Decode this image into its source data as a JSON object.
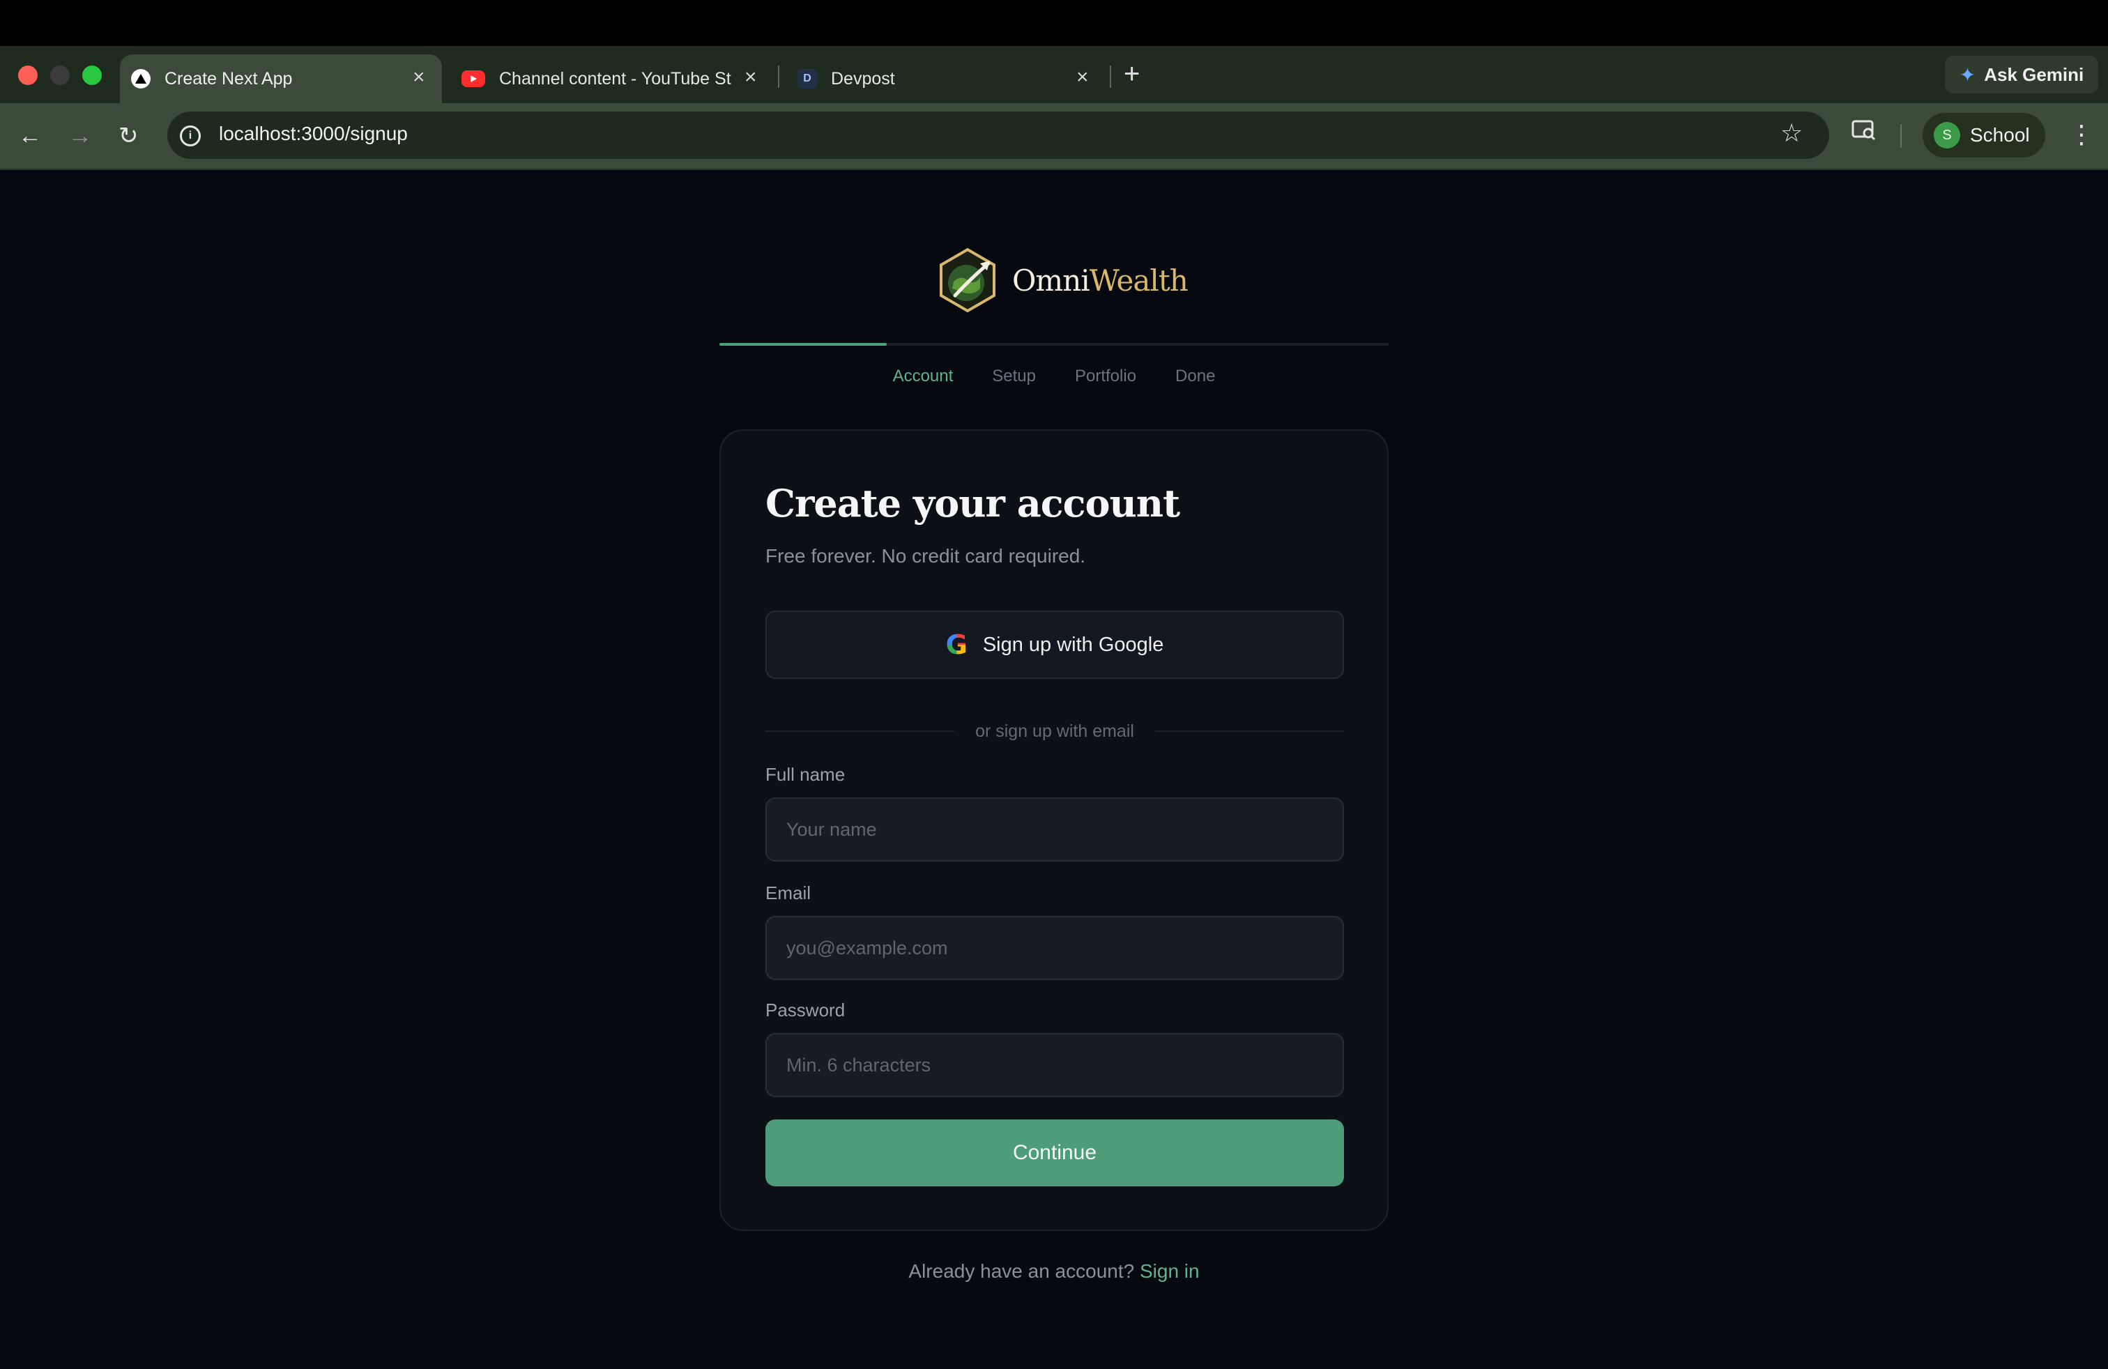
{
  "browser": {
    "tabs": [
      {
        "title": "Create Next App",
        "icon": "nextjs-icon",
        "active": true
      },
      {
        "title": "Channel content - YouTube Studio",
        "icon": "youtube-icon",
        "active": false
      },
      {
        "title": "Devpost",
        "icon": "devpost-icon",
        "active": false
      }
    ],
    "ask_gemini": "Ask Gemini",
    "url": "localhost:3000/signup",
    "profile_initial": "S",
    "profile_label": "School"
  },
  "brand": {
    "name_part1": "Omni",
    "name_part2": "Wealth",
    "accent": "#d9b86c"
  },
  "onboarding": {
    "progress_fraction": 0.25,
    "steps": [
      {
        "label": "Account",
        "active": true
      },
      {
        "label": "Setup",
        "active": false
      },
      {
        "label": "Portfolio",
        "active": false
      },
      {
        "label": "Done",
        "active": false
      }
    ]
  },
  "signup": {
    "title": "Create your account",
    "subtitle": "Free forever. No credit card required.",
    "google_button": "Sign up with Google",
    "divider": "or sign up with email",
    "fields": {
      "name": {
        "label": "Full name",
        "placeholder": "Your name",
        "value": ""
      },
      "email": {
        "label": "Email",
        "placeholder": "you@example.com",
        "value": ""
      },
      "password": {
        "label": "Password",
        "placeholder": "Min. 6 characters",
        "value": ""
      }
    },
    "continue": "Continue",
    "footer_text": "Already have an account?",
    "footer_link": "Sign in",
    "accent_color": "#4e9c7a"
  }
}
